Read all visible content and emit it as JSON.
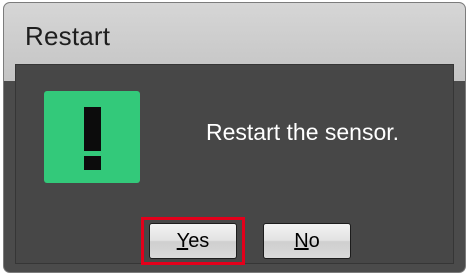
{
  "window": {
    "title": "Restart"
  },
  "dialog": {
    "icon": "exclamation-icon",
    "icon_color": "#33c97a",
    "message": "Restart the sensor."
  },
  "buttons": {
    "yes": {
      "mnemonic": "Y",
      "rest": "es"
    },
    "no": {
      "mnemonic": "N",
      "rest": "o"
    }
  },
  "highlight": {
    "target": "yes-button",
    "color": "#e3001b"
  }
}
